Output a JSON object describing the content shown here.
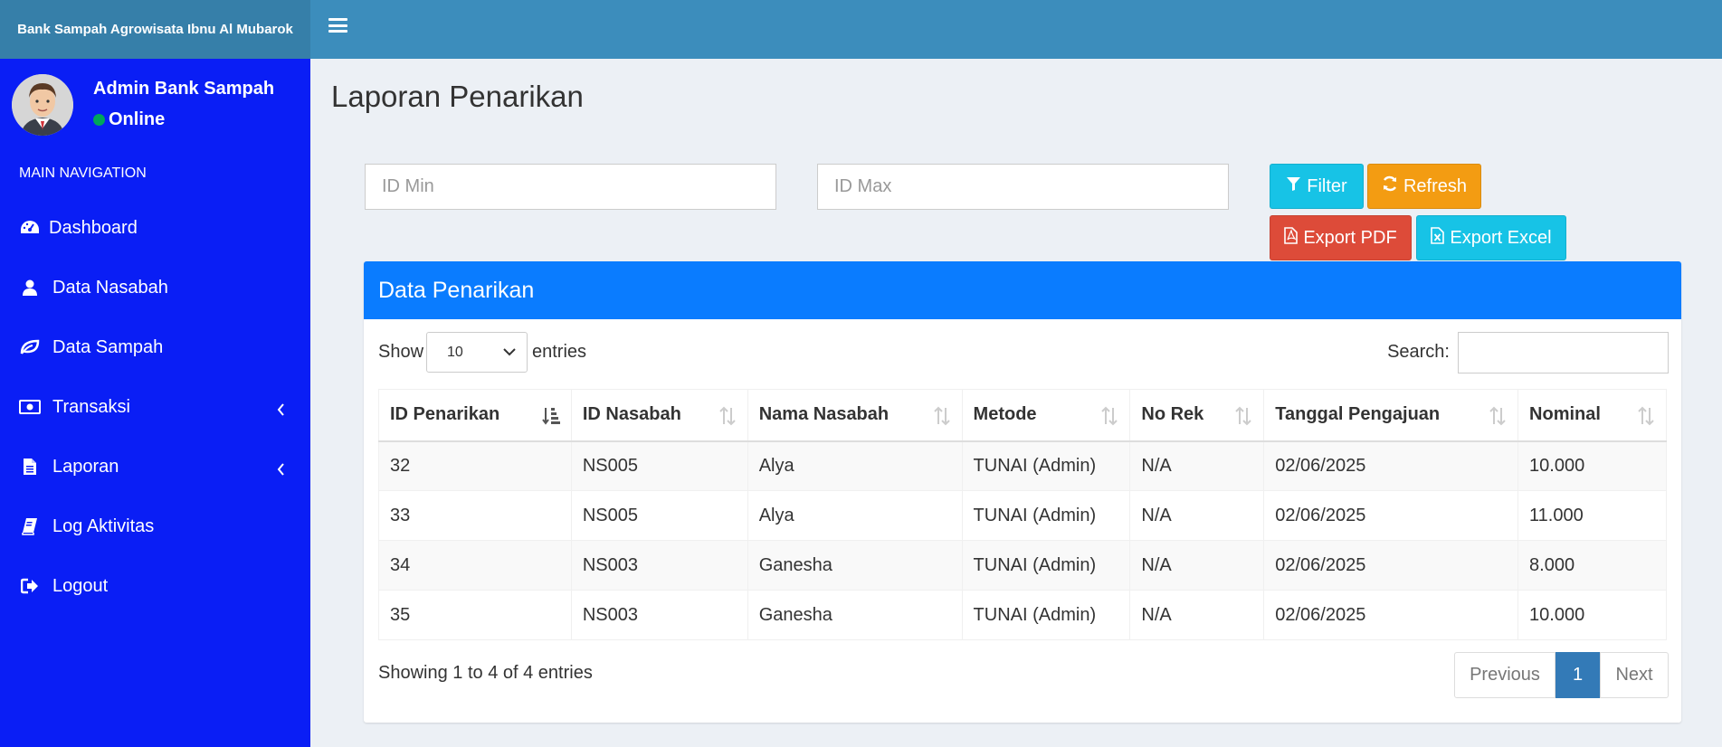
{
  "brand": {
    "title": "Bank Sampah Agrowisata Ibnu Al Mubarok"
  },
  "user": {
    "name": "Admin Bank Sampah",
    "status": "Online"
  },
  "sidebar": {
    "header": "MAIN NAVIGATION",
    "items": [
      {
        "label": "Dashboard",
        "icon": "dashboard-icon"
      },
      {
        "label": "Data Nasabah",
        "icon": "user-icon"
      },
      {
        "label": "Data Sampah",
        "icon": "leaf-icon"
      },
      {
        "label": "Transaksi",
        "icon": "money-icon",
        "has_submenu": true
      },
      {
        "label": "Laporan",
        "icon": "file-icon",
        "has_submenu": true
      },
      {
        "label": "Log Aktivitas",
        "icon": "book-icon"
      },
      {
        "label": "Logout",
        "icon": "sign-out-icon"
      }
    ]
  },
  "page": {
    "title": "Laporan Penarikan"
  },
  "filters": {
    "id_min_placeholder": "ID Min",
    "id_max_placeholder": "ID Max",
    "filter_label": "Filter",
    "refresh_label": "Refresh",
    "export_pdf_label": "Export PDF",
    "export_excel_label": "Export Excel"
  },
  "box": {
    "title": "Data Penarikan",
    "show_label": "Show",
    "entries_value": "10",
    "entries_label": "entries",
    "search_label": "Search:",
    "columns": [
      "ID Penarikan",
      "ID Nasabah",
      "Nama Nasabah",
      "Metode",
      "No Rek",
      "Tanggal Pengajuan",
      "Nominal"
    ],
    "rows": [
      [
        "32",
        "NS005",
        "Alya",
        "TUNAI (Admin)",
        "N/A",
        "02/06/2025",
        "10.000"
      ],
      [
        "33",
        "NS005",
        "Alya",
        "TUNAI (Admin)",
        "N/A",
        "02/06/2025",
        "11.000"
      ],
      [
        "34",
        "NS003",
        "Ganesha",
        "TUNAI (Admin)",
        "N/A",
        "02/06/2025",
        "8.000"
      ],
      [
        "35",
        "NS003",
        "Ganesha",
        "TUNAI (Admin)",
        "N/A",
        "02/06/2025",
        "10.000"
      ]
    ],
    "info": "Showing 1 to 4 of 4 entries",
    "pagination": {
      "previous": "Previous",
      "current": "1",
      "next": "Next"
    }
  },
  "colors": {
    "topbar": "#3c8dbc",
    "brand_bg": "#367fa9",
    "sidebar": "#0a1ef5",
    "box_header": "#0a7cff",
    "btn_info": "#17c3e6",
    "btn_warning": "#f39c12",
    "btn_danger": "#dd4b39",
    "status_online": "#00a65a"
  }
}
